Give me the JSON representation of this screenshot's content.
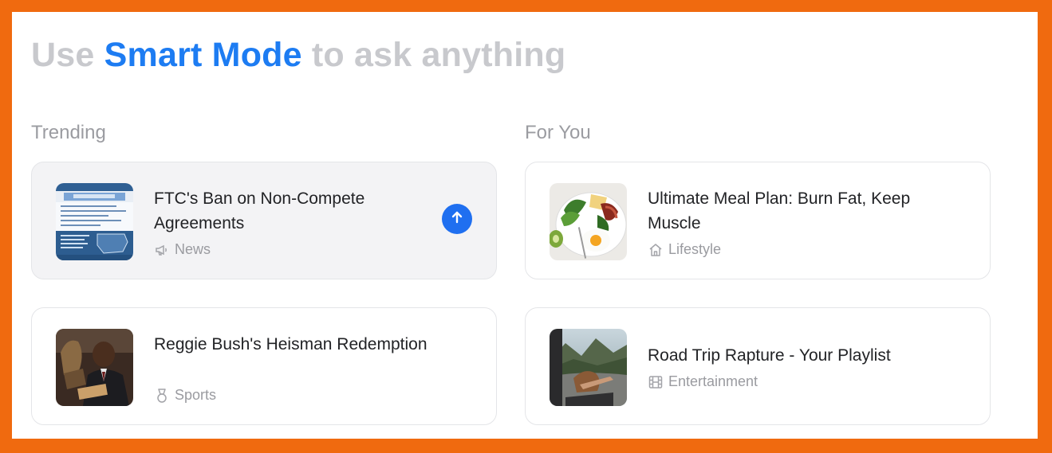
{
  "headline": {
    "prefix": "Use ",
    "accent": "Smart Mode",
    "suffix": " to ask anything"
  },
  "sections": {
    "trending_label": "Trending",
    "for_you_label": "For You"
  },
  "cards": [
    {
      "title": "FTC's Ban on Non-Compete Agreements",
      "category": "News",
      "category_icon": "megaphone-icon"
    },
    {
      "title": "Ultimate Meal Plan: Burn Fat, Keep Muscle",
      "category": "Lifestyle",
      "category_icon": "home-icon"
    },
    {
      "title": "Reggie Bush's Heisman Redemption",
      "category": "Sports",
      "category_icon": "medal-icon"
    },
    {
      "title": "Road Trip Rapture - Your Playlist",
      "category": "Entertainment",
      "category_icon": "film-icon"
    }
  ],
  "colors": {
    "accent": "#1d7cf2",
    "frame": "#f06a0f",
    "muted": "#9a9ba0"
  }
}
